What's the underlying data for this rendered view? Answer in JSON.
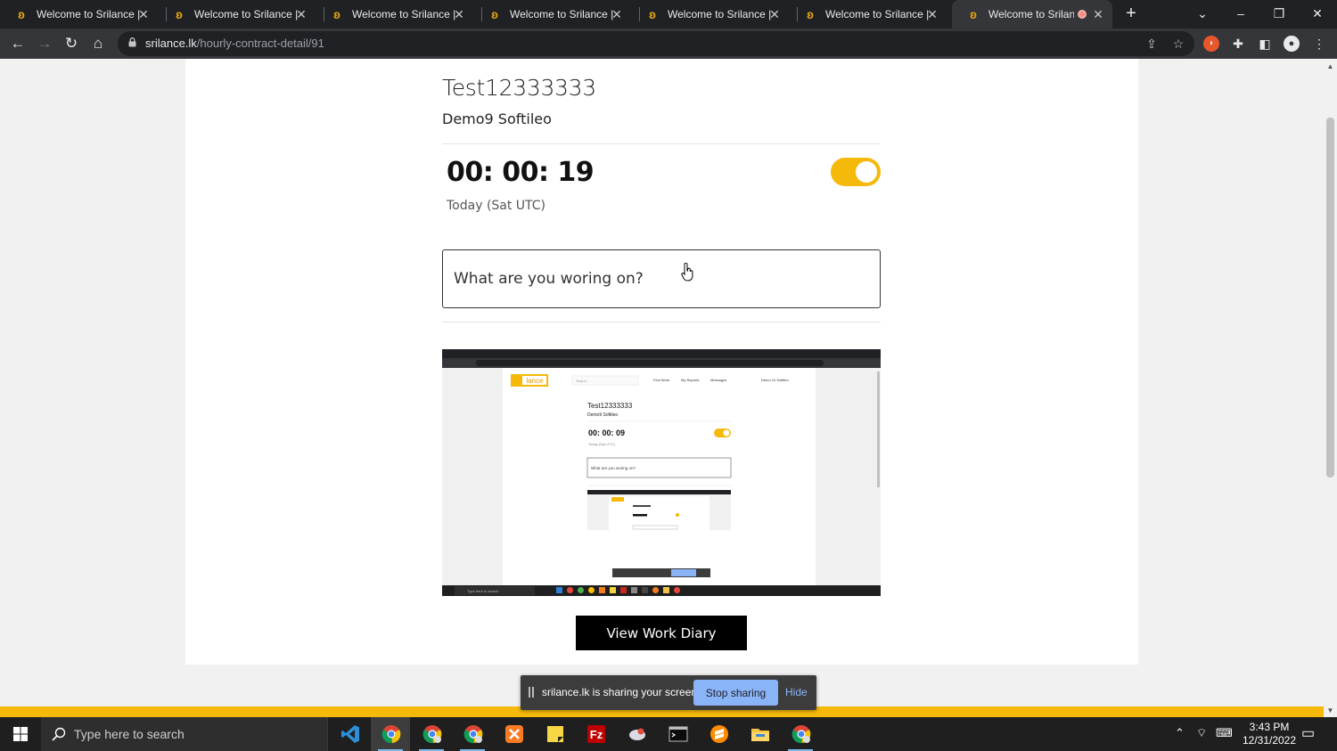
{
  "browser": {
    "tabs": [
      {
        "title": "Welcome to Srilance | F"
      },
      {
        "title": "Welcome to Srilance | F"
      },
      {
        "title": "Welcome to Srilance | F"
      },
      {
        "title": "Welcome to Srilance | F"
      },
      {
        "title": "Welcome to Srilance | F"
      },
      {
        "title": "Welcome to Srilance | F"
      },
      {
        "title": "Welcome to Srilanc"
      }
    ],
    "url_host": "srilance.lk",
    "url_path": "/hourly-contract-detail/91"
  },
  "contract": {
    "title": "Test12333333",
    "client": "Demo9 Softileo",
    "timer": "00: 00: 19",
    "today_label": "Today (Sat UTC)",
    "tracking_on": true,
    "work_placeholder": "What are you woring on?",
    "view_diary_label": "View Work Diary"
  },
  "screenshot_preview": {
    "logo": "lance",
    "search_placeholder": "Search",
    "nav": [
      "Find Work",
      "My Reports",
      "Messages"
    ],
    "user": "Demo 10 Softileo",
    "title": "Test12333333",
    "client": "Demo9 Softileo",
    "timer": "00: 00: 09",
    "today_label": "Today (Sat UTC)",
    "work_placeholder": "What are you woring on?",
    "taskbar_search": "Type here to search"
  },
  "sharing_bar": {
    "message": "srilance.lk is sharing your screen.",
    "stop_label": "Stop sharing",
    "hide_label": "Hide"
  },
  "taskbar": {
    "search_placeholder": "Type here to search",
    "time": "3:43 PM",
    "date": "12/31/2022"
  },
  "colors": {
    "accent": "#f5b90a",
    "button": "#000000",
    "share_button": "#8ab4f8"
  }
}
